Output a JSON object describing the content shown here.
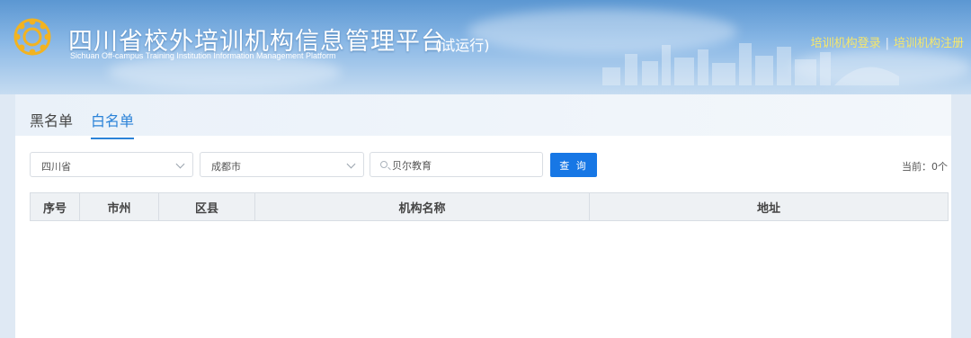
{
  "header": {
    "title": "四川省校外培训机构信息管理平台",
    "subtitle": "Sichuan Off-campus Training Institution Information Management Platform",
    "trial": "(试运行)",
    "login_link": "培训机构登录",
    "separator": "|",
    "register_link": "培训机构注册"
  },
  "tabs": [
    {
      "label": "黑名单",
      "active": false
    },
    {
      "label": "白名单",
      "active": true
    }
  ],
  "filters": {
    "province": "四川省",
    "city": "成都市",
    "search_value": "贝尔教育",
    "query_button": "查 询",
    "count_text": "当前：0个"
  },
  "table": {
    "columns": [
      "序号",
      "市州",
      "区县",
      "机构名称",
      "地址"
    ]
  },
  "colors": {
    "accent": "#1777e5",
    "link_yellow": "#f7e76b",
    "tab_active": "#2b83d8"
  }
}
